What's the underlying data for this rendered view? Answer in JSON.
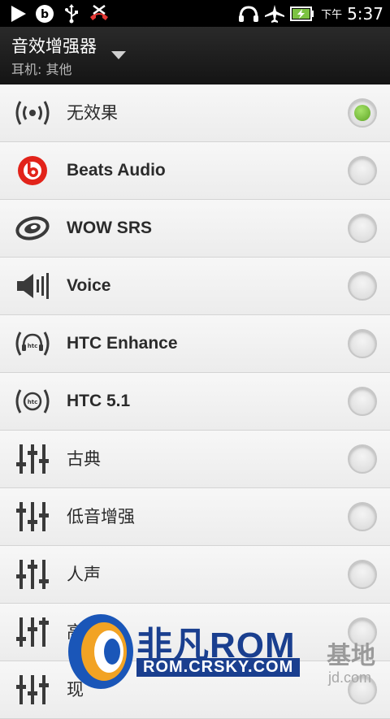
{
  "status_bar": {
    "icons": [
      "play-icon",
      "beats-icon",
      "usb-icon",
      "missed-call-icon",
      "headphones-icon",
      "airplane-mode-icon",
      "battery-charging-icon"
    ],
    "ampm": "下午",
    "time": "5:37"
  },
  "title_bar": {
    "title": "音效增强器",
    "subtitle": "耳机: 其他"
  },
  "options": [
    {
      "label": "无效果",
      "icon": "no-effect-icon",
      "selected": true
    },
    {
      "label": "Beats Audio",
      "icon": "beats-audio-icon",
      "selected": false
    },
    {
      "label": "WOW SRS",
      "icon": "srs-wow-icon",
      "selected": false
    },
    {
      "label": "Voice",
      "icon": "speaker-icon",
      "selected": false
    },
    {
      "label": "HTC Enhance",
      "icon": "htc-enhance-icon",
      "selected": false
    },
    {
      "label": "HTC 5.1",
      "icon": "htc-51-icon",
      "selected": false
    },
    {
      "label": "古典",
      "icon": "equalizer-icon",
      "selected": false
    },
    {
      "label": "低音增强",
      "icon": "equalizer-icon",
      "selected": false
    },
    {
      "label": "人声",
      "icon": "equalizer-icon",
      "selected": false
    },
    {
      "label": "高",
      "icon": "equalizer-icon",
      "selected": false
    },
    {
      "label": "现",
      "icon": "equalizer-icon",
      "selected": false
    }
  ],
  "watermark": {
    "brand": "非凡ROM",
    "site": "ROM.CRSKY.COM",
    "cn_suffix": "基地",
    "site_suffix": "jd.com"
  },
  "colors": {
    "selected_radio": "#6ab32f",
    "watermark_blue": "#1a3f8f"
  }
}
